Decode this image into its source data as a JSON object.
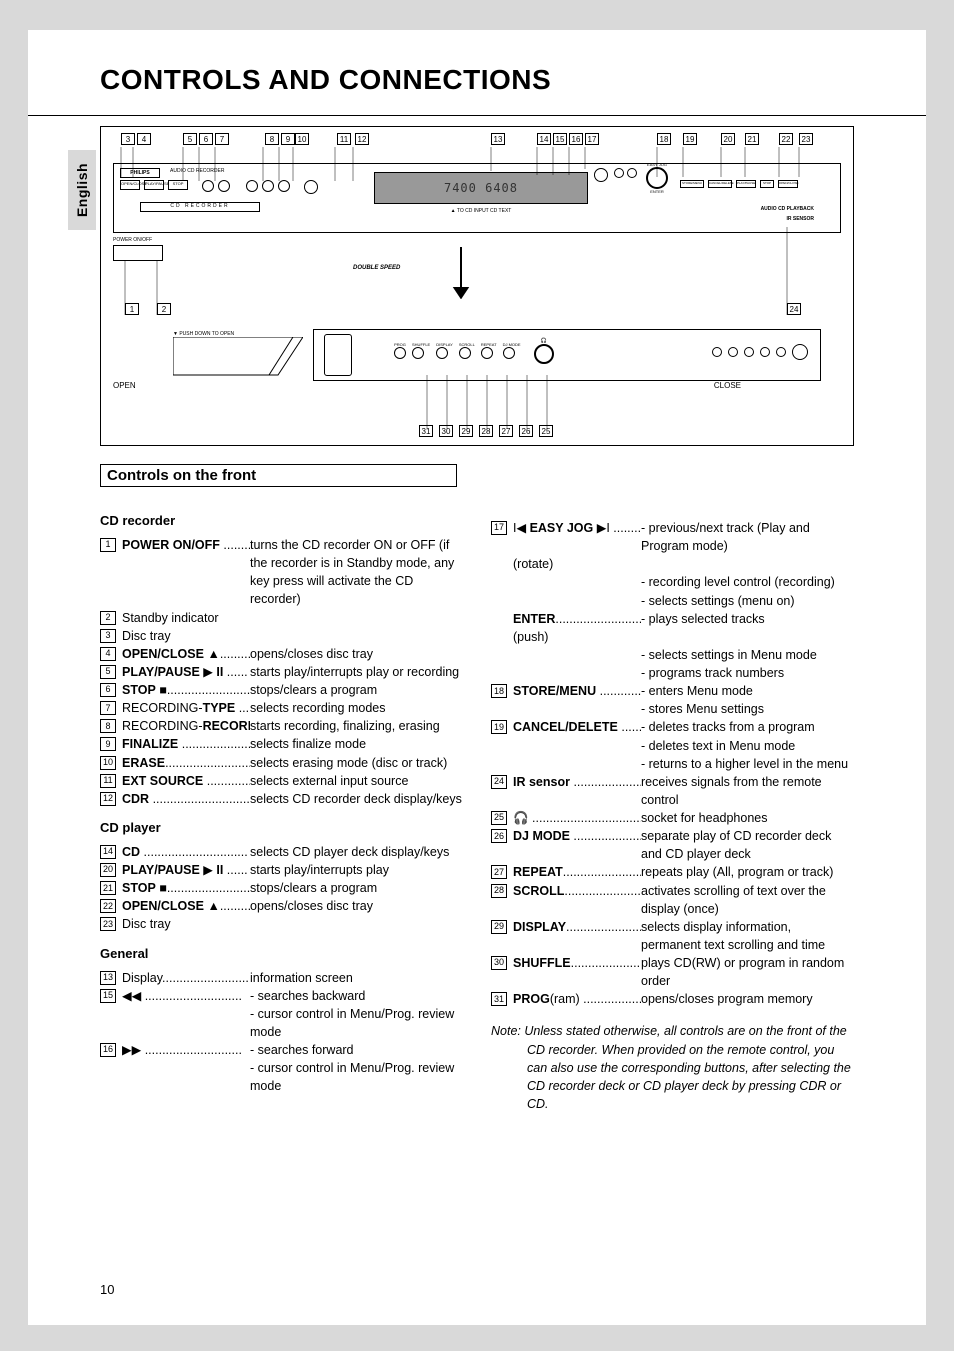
{
  "page_number": "10",
  "language_tab": "English",
  "title": "CONTROLS AND CONNECTIONS",
  "section_title": "Controls on the front",
  "diagram": {
    "top_callouts": [
      "3",
      "4",
      "5",
      "6",
      "7",
      "8",
      "9",
      "10",
      "11",
      "12",
      "13",
      "14",
      "15",
      "16",
      "17",
      "18",
      "19",
      "20",
      "21",
      "22",
      "23"
    ],
    "mid_callouts": [
      "1",
      "2",
      "24"
    ],
    "bottom_callouts": [
      "31",
      "30",
      "29",
      "28",
      "27",
      "26",
      "25"
    ],
    "labels": {
      "brand": "PHILIPS",
      "recorder_title": "AUDIO CD RECORDER",
      "cd_recorder": "CD RECORDER",
      "power": "POWER ON/OFF",
      "double_speed": "DOUBLE SPEED",
      "push_open": "▼ PUSH DOWN TO OPEN",
      "open": "OPEN",
      "close": "CLOSE",
      "playback": "AUDIO CD PLAYBACK",
      "ir": "IR SENSOR",
      "ir_note": "▲ TO CD INPUT CD TEXT",
      "easy_jog": "EASY JOG",
      "display_value": "7400 6408",
      "btn_open_close": "OPEN/CLOSE",
      "btn_play_pause": "PLAY/PAUSE",
      "btn_stop": "STOP",
      "btn_type": "TYPE",
      "btn_record": "RECORD",
      "btn_finalize": "FINALIZE",
      "btn_erase": "ERASE",
      "btn_ext_source": "EXT SOURCE",
      "btn_cdr": "CDR",
      "btn_store_menu": "STORE/MENU",
      "btn_cancel_delete": "CANCEL/DELETE",
      "btn_cd": "CD",
      "btn_prog": "PROG",
      "btn_shuffle": "SHUFFLE",
      "btn_display": "DISPLAY",
      "btn_scroll": "SCROLL",
      "btn_repeat": "REPEAT",
      "btn_dj_mode": "DJ MODE",
      "btn_enter": "ENTER",
      "optical": "OPTICAL",
      "rec": "REC",
      "track": "TRACK",
      "rec_type": "REC TYPE"
    }
  },
  "cd_recorder_heading": "CD recorder",
  "cd_player_heading": "CD player",
  "general_heading": "General",
  "items_left_recorder": [
    {
      "n": "1",
      "label": "<b>POWER ON/OFF</b> ........",
      "desc": "turns the CD recorder ON or OFF (if the recorder is in Standby mode, any key press will activate the CD recorder)"
    },
    {
      "n": "2",
      "label": "Standby indicator",
      "desc": ""
    },
    {
      "n": "3",
      "label": "Disc tray",
      "desc": ""
    },
    {
      "n": "4",
      "label": "<b>OPEN/CLOSE</b> ▲...........",
      "desc": "opens/closes disc tray"
    },
    {
      "n": "5",
      "label": "<b>PLAY/PAUSE</b> ▶ <b>II</b> ......",
      "desc": "starts play/interrupts play or recording"
    },
    {
      "n": "6",
      "label": "<b>STOP</b> ■.........................",
      "desc": "stops/clears a program"
    },
    {
      "n": "7",
      "label": "RECORDING-<b>TYPE</b> ......",
      "desc": "selects recording modes"
    },
    {
      "n": "8",
      "label": "RECORDING-<b>RECORD</b>…",
      "desc": "starts recording, finalizing, erasing"
    },
    {
      "n": "9",
      "label": "<b>FINALIZE</b> ....................",
      "desc": "selects finalize mode"
    },
    {
      "n": "10",
      "label": "<b>ERASE</b>..........................",
      "desc": "selects erasing mode (disc or track)"
    },
    {
      "n": "11",
      "label": "<b>EXT SOURCE</b> ..............",
      "desc": "selects external input source"
    },
    {
      "n": "12",
      "label": "<b>CDR</b>  ............................",
      "desc": "selects CD recorder deck display/keys"
    }
  ],
  "items_left_player": [
    {
      "n": "14",
      "label": "<b>CD</b>  ..............................",
      "desc": "selects CD player deck display/keys"
    },
    {
      "n": "20",
      "label": "<b>PLAY/PAUSE</b> ▶ <b>II</b> ......",
      "desc": "starts play/interrupts play"
    },
    {
      "n": "21",
      "label": "<b>STOP</b> ■.........................",
      "desc": "stops/clears a program"
    },
    {
      "n": "22",
      "label": "<b>OPEN/CLOSE</b> ▲...........",
      "desc": "opens/closes disc tray"
    },
    {
      "n": "23",
      "label": "Disc tray",
      "desc": ""
    }
  ],
  "items_left_general": [
    {
      "n": "13",
      "label": "Display...........................",
      "desc": "information screen"
    },
    {
      "n": "15",
      "label": "◀◀  ............................",
      "desc": "- searches backward",
      "extra": "- cursor control in Menu/Prog. review mode"
    },
    {
      "n": "16",
      "label": "▶▶  ............................",
      "desc": "- searches forward",
      "extra": "- cursor control in Menu/Prog. review mode"
    }
  ],
  "items_right": [
    {
      "n": "17",
      "label": "I◀ <b>EASY JOG</b> ▶I  ........",
      "sub": "(rotate)",
      "desc": "- previous/next track (Play and Program mode)",
      "extra": "- recording level control (recording)\n- selects settings (menu on)"
    },
    {
      "n": "",
      "label": "<b>ENTER</b>..........................",
      "sub": "(push)",
      "desc": "- plays selected tracks",
      "extra": "- selects settings in Menu mode\n- programs track numbers"
    },
    {
      "n": "18",
      "label": "<b>STORE/MENU</b> ............",
      "desc": "- enters Menu mode",
      "extra": "- stores Menu settings"
    },
    {
      "n": "19",
      "label": "<b>CANCEL/DELETE</b>  ......",
      "desc": "- deletes tracks from a program",
      "extra": "- deletes text in Menu mode\n- returns to a higher level in the menu"
    },
    {
      "n": "24",
      "label": "<b>IR sensor</b> ....................",
      "desc": "receives signals from the remote control"
    },
    {
      "n": "25",
      "label": "🎧 ................................",
      "desc": "socket for headphones"
    },
    {
      "n": "26",
      "label": "<b>DJ MODE</b> ....................",
      "desc": "separate play of CD recorder deck and CD player deck"
    },
    {
      "n": "27",
      "label": "<b>REPEAT</b>........................",
      "desc": "repeats play (All, program or track)"
    },
    {
      "n": "28",
      "label": "<b>SCROLL</b>........................",
      "desc": "activates scrolling of text over the display (once)"
    },
    {
      "n": "29",
      "label": "<b>DISPLAY</b>......................",
      "desc": "selects display information, permanent text scrolling and time"
    },
    {
      "n": "30",
      "label": "<b>SHUFFLE</b>......................",
      "desc": "plays CD(RW) or program in random order"
    },
    {
      "n": "31",
      "label": "<b>PROG</b>(ram) ..................",
      "desc": "opens/closes program memory"
    }
  ],
  "note": "Note: Unless stated otherwise, all controls are on the front of the CD recorder. When provided on the remote control, you can also use the corresponding buttons, after selecting the CD recorder deck or CD player deck by pressing CDR or CD."
}
